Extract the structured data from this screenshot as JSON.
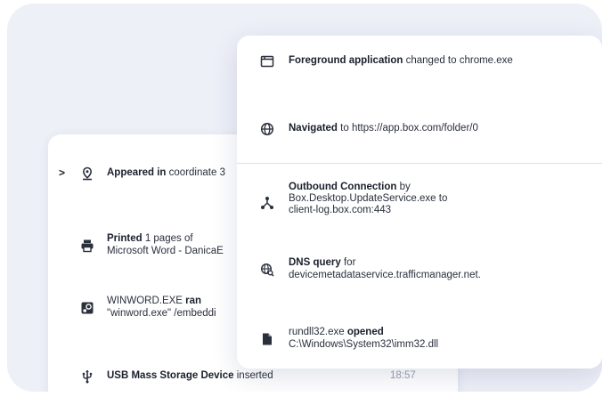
{
  "back_card": {
    "items": [
      {
        "icon": "location-pin-icon",
        "bold": "Appeared in",
        "text": " coordinate 3"
      },
      {
        "icon": "printer-icon",
        "bold": "Printed",
        "text": " 1 pages of",
        "line2": "Microsoft Word - DanicaE"
      },
      {
        "icon": "executable-icon",
        "text": "WINWORD.EXE ",
        "bold": "ran",
        "line2": "\"winword.exe\"  /embeddi"
      },
      {
        "icon": "usb-icon",
        "bold": "USB Mass Storage Device",
        "text": " inserted",
        "time": "18:57"
      }
    ],
    "expand_chevron": ">"
  },
  "front_card": {
    "items": [
      {
        "icon": "window-icon",
        "bold": "Foreground application",
        "text": " changed to chrome.exe"
      },
      {
        "icon": "globe-icon",
        "bold": "Navigated",
        "text": " to https://app.box.com/folder/0"
      },
      {
        "icon": "network-connection-icon",
        "bold": "Outbound Connection",
        "text": " by",
        "line2": "Box.Desktop.UpdateService.exe to",
        "line3": "client-log.box.com:443"
      },
      {
        "icon": "dns-search-icon",
        "bold": "DNS query",
        "text": " for",
        "line2": "devicemetadataservice.trafficmanager.net."
      },
      {
        "icon": "file-icon",
        "text": "rundll32.exe ",
        "bold": "opened",
        "line2": "C:\\Windows\\System32\\imm32.dll"
      }
    ]
  }
}
